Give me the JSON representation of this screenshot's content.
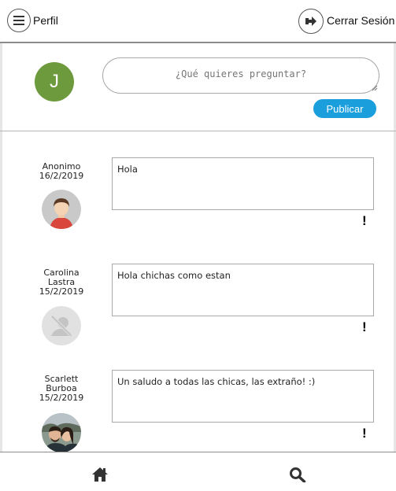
{
  "header": {
    "profile_label": "Perfil",
    "logout_label": "Cerrar Sesión"
  },
  "compose": {
    "avatar_initial": "J",
    "avatar_color": "#6c9a3c",
    "placeholder": "¿Qué quieres preguntar?",
    "publish_label": "Publicar",
    "accent": "#1a9fdc"
  },
  "posts": [
    {
      "author_lines": [
        "Anonimo"
      ],
      "date": "16/2/2019",
      "message": "Hola",
      "avatar": "anonymous-cartoon-avatar",
      "report_label": "!"
    },
    {
      "author_lines": [
        "Carolina",
        "Lastra"
      ],
      "date": "15/2/2019",
      "message": "Hola chichas como estan",
      "avatar": "no-photo-placeholder-icon",
      "report_label": "!"
    },
    {
      "author_lines": [
        "Scarlett",
        "Burboa"
      ],
      "date": "15/2/2019",
      "message": "Un saludo a todas las chicas, las extraño! :)",
      "avatar": "couple-photo-avatar",
      "report_label": "!"
    }
  ],
  "bottom_nav": {
    "home_icon": "home-icon",
    "search_icon": "search-icon"
  }
}
